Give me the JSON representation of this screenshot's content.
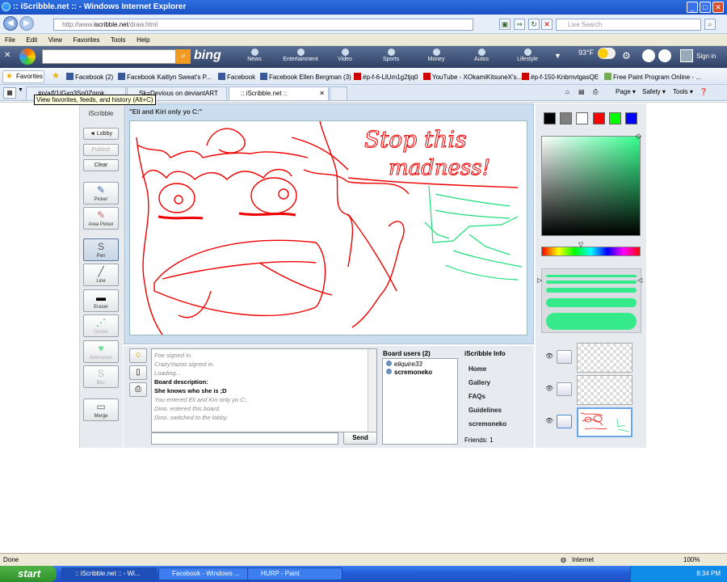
{
  "window": {
    "title": ":: iScribble.net :: - Windows Internet Explorer"
  },
  "address": {
    "url_prefix": "http://www.",
    "url_domain": "iscribble.net",
    "url_path": "/draw.html",
    "search_placeholder": "Live Search"
  },
  "menu": [
    "File",
    "Edit",
    "View",
    "Favorites",
    "Tools",
    "Help"
  ],
  "bing": {
    "logo": "bing",
    "tabs": [
      "News",
      "Entertainment",
      "Video",
      "Sports",
      "Money",
      "Autos",
      "Lifestyle"
    ],
    "weather": "93°F",
    "signin": "Sign in"
  },
  "favorites": {
    "button": "Favorites",
    "items": [
      "Facebook (2)",
      "Facebook  Kaitlyn Sweat's P...",
      "Facebook",
      "Facebook  Ellen Bergman (3)",
      "#p-f-6-LlUm1g2tjq0",
      "YouTube - XOkamiKitsuneX's...",
      "#p-f-150-KnbmvtgasQE",
      "Free Paint Program Online - ..."
    ]
  },
  "tabs": [
    "#p/a/f/1/Gxq3Sp0Zqmk",
    "Sk=Devious on deviantART",
    ":: iScribble.net ::"
  ],
  "tooltip": "View favorites, feeds, and history (Alt+C)",
  "toolbar_right": {
    "page": "Page ▾",
    "safety": "Safety ▾",
    "tools": "Tools ▾"
  },
  "left_panel": {
    "title": "iScribble",
    "buttons": {
      "lobby": "◄ Lobby",
      "publish": "Publish",
      "clear": "Clear",
      "merge": "Merge"
    },
    "tools": [
      "Picker",
      "Area Picker",
      "Pen",
      "Line",
      "Eraser",
      "Circles",
      "Airbrushes",
      "Blur"
    ]
  },
  "board": {
    "title": "\"Eli and Kiri only yo C:\""
  },
  "canvas_text": {
    "line1": "Stop this",
    "line2": "madness!"
  },
  "chat": {
    "lines": [
      {
        "t": "Foe signed in.",
        "style": "sys"
      },
      {
        "t": "CrazyYazoo signed in.",
        "style": "sys"
      },
      {
        "t": "Loading...",
        "style": "sys"
      },
      {
        "t": "Board description:",
        "style": "bold"
      },
      {
        "t": "She knows who she is ;D",
        "style": "bold"
      },
      {
        "t": "You entered Eli and Kiri only yo C:.",
        "style": "sys"
      },
      {
        "t": "Dino. entered this board.",
        "style": "sys"
      },
      {
        "t": "Dino. switched to the lobby.",
        "style": "sys"
      }
    ],
    "send": "Send"
  },
  "users": {
    "header": "Board users (2)",
    "list": [
      "eliquire33",
      "scremoneko"
    ]
  },
  "info": {
    "header": "iScribble Info",
    "links": [
      "Home",
      "Gallery",
      "FAQs",
      "Guidelines",
      "scremoneko"
    ],
    "friends": "Friends: 1"
  },
  "palette": {
    "swatches": [
      "#000000",
      "#808080",
      "#ffffff",
      "#ff0000",
      "#00ff00",
      "#0000ff"
    ],
    "current": "#35ea8a"
  },
  "status": {
    "left": "Done",
    "zone": "Internet",
    "zoom": "100%"
  },
  "taskbar": {
    "start": "start",
    "items": [
      ":: iScribble.net :: - Wi...",
      "Facebook - Windows ...",
      "HURP - Paint"
    ],
    "clock": "8:34 PM"
  }
}
